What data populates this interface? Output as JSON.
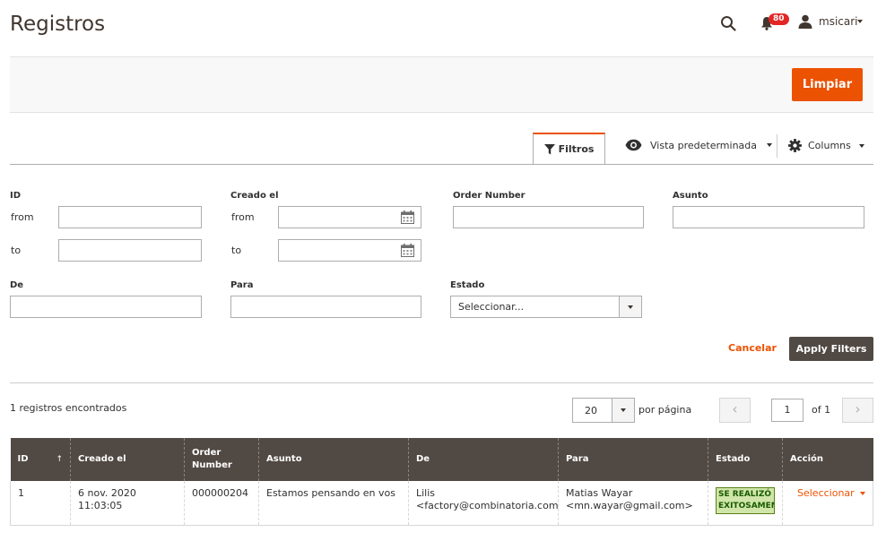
{
  "header": {
    "title": "Registros",
    "notifications_count": "80",
    "user_name": "msicari"
  },
  "actions": {
    "clear_label": "Limpiar"
  },
  "toolbar": {
    "filters_tab": "Filtros",
    "view_label": "Vista predeterminada",
    "columns_label": "Columns"
  },
  "filters": {
    "id_label": "ID",
    "created_label": "Creado el",
    "order_number_label": "Order Number",
    "subject_label": "Asunto",
    "from_label": "from",
    "to_label": "to",
    "de_label": "De",
    "para_label": "Para",
    "estado_label": "Estado",
    "estado_value": "Seleccionar...",
    "cancel_label": "Cancelar",
    "apply_label": "Apply Filters"
  },
  "pager": {
    "records_found": "1 registros encontrados",
    "per_page_value": "20",
    "per_page_label": "por página",
    "prev": "‹",
    "next": "›",
    "current_page": "1",
    "of_label": "of 1"
  },
  "table": {
    "columns": [
      "ID",
      "Creado el",
      "Order Number",
      "Asunto",
      "De",
      "Para",
      "Estado",
      "Acción"
    ],
    "sort_indicator": "↑",
    "rows": [
      {
        "id": "1",
        "created": "6 nov. 2020 11:03:05",
        "order_number": "000000204",
        "subject": "Estamos pensando en vos",
        "de_name": "Lilis",
        "de_email": "<factory@combinatoria.com",
        "para_name": "Matias Wayar",
        "para_email": "<mn.wayar@gmail.com>",
        "status_line1": "SE REALIZÓ",
        "status_line2": "EXITOSAMENTE",
        "action": "Seleccionar"
      }
    ]
  },
  "colors": {
    "accent": "#eb5202",
    "header_bg": "#514943",
    "status_bg": "#d0e5a9",
    "badge": "#e22626"
  }
}
